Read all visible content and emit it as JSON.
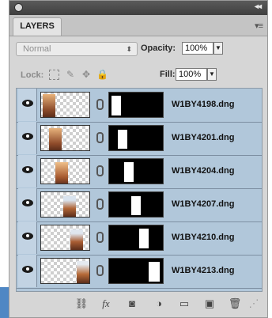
{
  "panel": {
    "tab_label": "LAYERS",
    "blend_mode": "Normal",
    "opacity_label": "Opacity:",
    "opacity_value": "100%",
    "lock_label": "Lock:",
    "fill_label": "Fill:",
    "fill_value": "100%"
  },
  "layers": [
    {
      "name": "W1BY4198.dng"
    },
    {
      "name": "W1BY4201.dng"
    },
    {
      "name": "W1BY4204.dng"
    },
    {
      "name": "W1BY4207.dng"
    },
    {
      "name": "W1BY4210.dng"
    },
    {
      "name": "W1BY4213.dng"
    }
  ],
  "footer_icons": [
    "link-icon",
    "fx-icon",
    "mask-icon",
    "adjustment-icon",
    "group-folder-icon",
    "new-layer-icon",
    "trash-icon"
  ],
  "colors": {
    "selection": "#b1c7da",
    "panel_bg": "#d6d6d6",
    "titlebar": "#4a4a4a"
  }
}
